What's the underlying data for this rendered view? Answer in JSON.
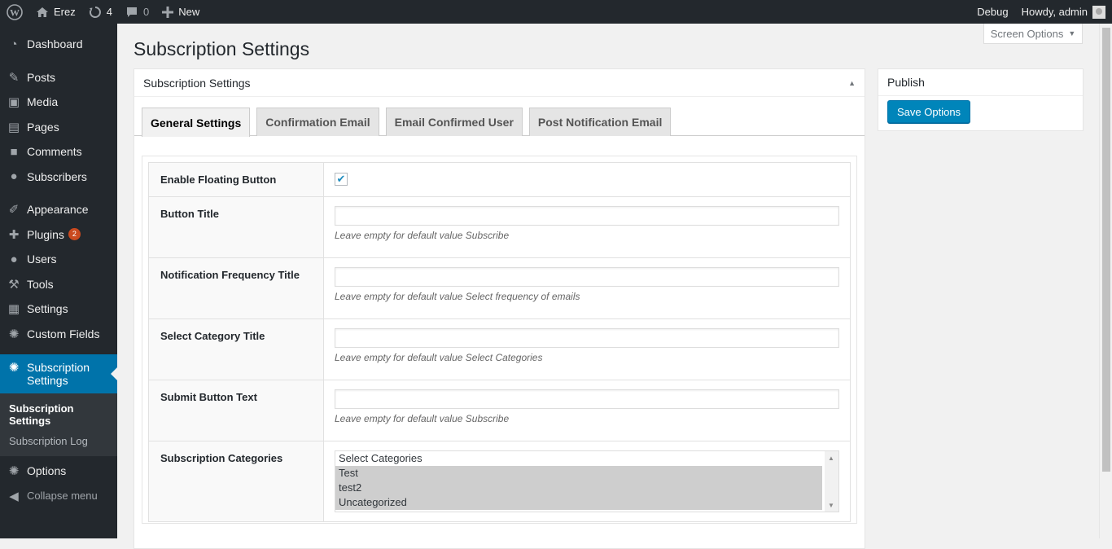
{
  "adminbar": {
    "site_name": "Erez",
    "updates_count": "4",
    "comments_count": "0",
    "new_label": "New",
    "debug_label": "Debug",
    "howdy_label": "Howdy, admin"
  },
  "sidebar": {
    "items": [
      {
        "label": "Dashboard",
        "icon": "dashboard-icon"
      },
      {
        "label": "Posts",
        "icon": "pin-icon"
      },
      {
        "label": "Media",
        "icon": "media-icon"
      },
      {
        "label": "Pages",
        "icon": "pages-icon"
      },
      {
        "label": "Comments",
        "icon": "comments-icon"
      },
      {
        "label": "Subscribers",
        "icon": "groups-icon"
      },
      {
        "label": "Appearance",
        "icon": "brush-icon"
      },
      {
        "label": "Plugins",
        "icon": "plugin-icon",
        "badge": "2"
      },
      {
        "label": "Users",
        "icon": "users-icon"
      },
      {
        "label": "Tools",
        "icon": "wrench-icon"
      },
      {
        "label": "Settings",
        "icon": "settings-icon"
      },
      {
        "label": "Custom Fields",
        "icon": "gear-icon"
      },
      {
        "label": "Subscription Settings",
        "icon": "gear-icon"
      },
      {
        "label": "Options",
        "icon": "gear-icon"
      }
    ],
    "submenu": [
      "Subscription Settings",
      "Subscription Log"
    ],
    "collapse_label": "Collapse menu"
  },
  "header": {
    "screen_options": "Screen Options",
    "page_title": "Subscription Settings"
  },
  "postbox": {
    "title": "Subscription Settings",
    "tabs": [
      "General Settings",
      "Confirmation Email",
      "Email Confirmed User",
      "Post Notification Email"
    ],
    "active_tab": "General Settings"
  },
  "form": {
    "enable_floating_label": "Enable Floating Button",
    "enable_floating_checked": true,
    "button_title_label": "Button Title",
    "button_title_value": "",
    "button_title_desc": "Leave empty for default value Subscribe",
    "freq_title_label": "Notification Frequency Title",
    "freq_title_value": "",
    "freq_title_desc": "Leave empty for default value Select frequency of emails",
    "cat_title_label": "Select Category Title",
    "cat_title_value": "",
    "cat_title_desc": "Leave empty for default value Select Categories",
    "submit_text_label": "Submit Button Text",
    "submit_text_value": "",
    "submit_text_desc": "Leave empty for default value Subscribe",
    "categories_label": "Subscription Categories",
    "categories_options": [
      "Select Categories",
      "Test",
      "test2",
      "Uncategorized"
    ],
    "categories_selected": [
      "Test",
      "test2",
      "Uncategorized"
    ]
  },
  "publish": {
    "title": "Publish",
    "save_label": "Save Options"
  },
  "colors": {
    "adminbar_bg": "#23282d",
    "accent": "#0073aa",
    "button_primary": "#0085ba",
    "badge": "#ca4a1f"
  }
}
